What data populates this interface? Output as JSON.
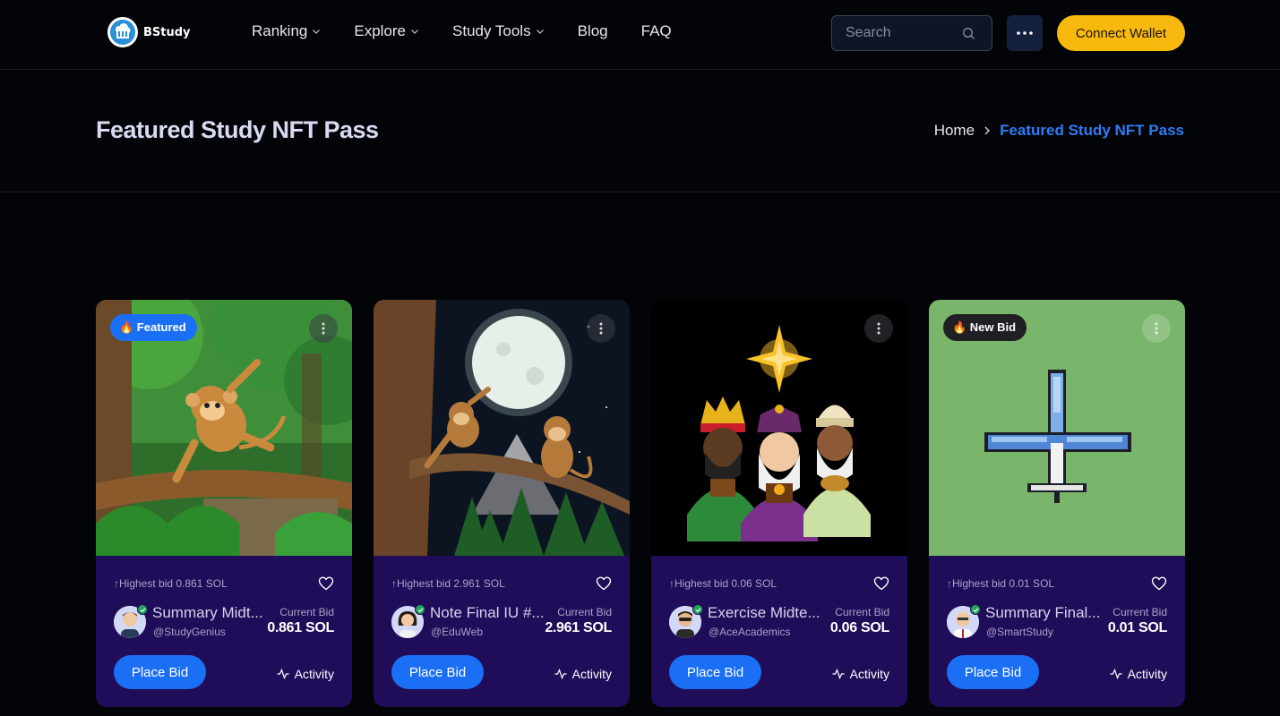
{
  "app": {
    "logo_text": "BStudy"
  },
  "nav": [
    {
      "label": "Ranking",
      "dropdown": true
    },
    {
      "label": "Explore",
      "dropdown": true
    },
    {
      "label": "Study Tools",
      "dropdown": true
    },
    {
      "label": "Blog",
      "dropdown": false
    },
    {
      "label": "FAQ",
      "dropdown": false
    }
  ],
  "search": {
    "placeholder": "Search",
    "icon": "search-icon"
  },
  "header": {
    "more_icon": "more-dots-icon",
    "connect_label": "Connect Wallet"
  },
  "hero": {
    "title": "Featured Study NFT Pass",
    "breadcrumb": {
      "home": "Home",
      "current": "Featured Study NFT Pass"
    }
  },
  "colors": {
    "accent": "#1b6ff5",
    "wallet": "#f8b90f",
    "card_bg": "#1f0d59",
    "breadcrumb_active": "#2f7cf6"
  },
  "cards": [
    {
      "badge": "🔥 Featured",
      "badge_style": "blue",
      "highest_bid": "↑Highest bid 0.861 SOL",
      "name": "Summary Midt...",
      "handle": "@StudyGenius",
      "current_bid_label": "Current Bid",
      "current_bid": "0.861 SOL",
      "cta": "Place Bid",
      "activity": "Activity",
      "image": "monkey-in-jungle"
    },
    {
      "badge": "",
      "badge_style": "",
      "highest_bid": "↑Highest bid 2.961 SOL",
      "name": "Note Final IU #...",
      "handle": "@EduWeb",
      "current_bid_label": "Current Bid",
      "current_bid": "2.961 SOL",
      "cta": "Place Bid",
      "activity": "Activity",
      "image": "monkeys-under-moon"
    },
    {
      "badge": "",
      "badge_style": "",
      "highest_bid": "↑Highest bid 0.06 SOL",
      "name": "Exercise Midte...",
      "handle": "@AceAcademics",
      "current_bid_label": "Current Bid",
      "current_bid": "0.06 SOL",
      "cta": "Place Bid",
      "activity": "Activity",
      "image": "three-wise-men"
    },
    {
      "badge": "🔥 New Bid",
      "badge_style": "dark",
      "highest_bid": "↑Highest bid 0.01 SOL",
      "name": "Summary Final...",
      "handle": "@SmartStudy",
      "current_bid_label": "Current Bid",
      "current_bid": "0.01 SOL",
      "cta": "Place Bid",
      "activity": "Activity",
      "image": "pixel-airplane"
    }
  ]
}
